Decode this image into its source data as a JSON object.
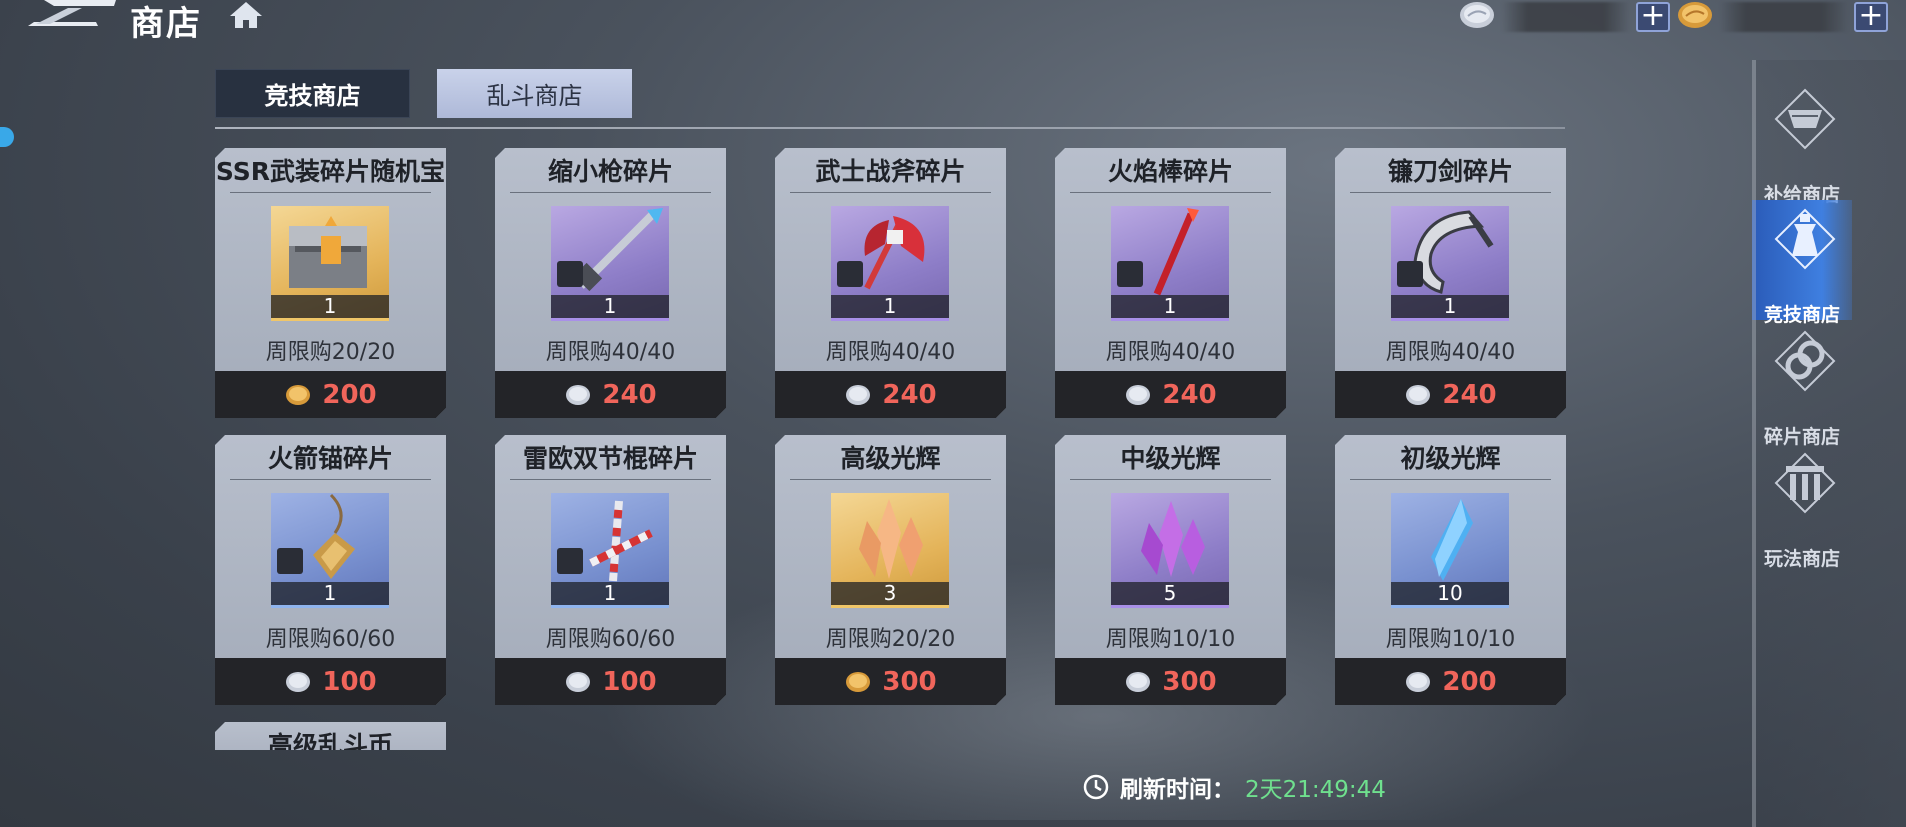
{
  "header": {
    "title": "商店"
  },
  "currencies": [
    {
      "icon": "silver-coin-icon",
      "amount": ""
    },
    {
      "icon": "gold-coin-icon",
      "amount": ""
    }
  ],
  "tabs": [
    {
      "label": "竞技商店",
      "active": true
    },
    {
      "label": "乱斗商店",
      "active": false
    }
  ],
  "items": [
    {
      "name": "SSR武装碎片随机宝",
      "qty": "1",
      "limit": "周限购20/20",
      "price": "200",
      "coin": "gold",
      "rarity": "gold"
    },
    {
      "name": "缩小枪碎片",
      "qty": "1",
      "limit": "周限购40/40",
      "price": "240",
      "coin": "silver",
      "rarity": "purple"
    },
    {
      "name": "武士战斧碎片",
      "qty": "1",
      "limit": "周限购40/40",
      "price": "240",
      "coin": "silver",
      "rarity": "purple"
    },
    {
      "name": "火焰棒碎片",
      "qty": "1",
      "limit": "周限购40/40",
      "price": "240",
      "coin": "silver",
      "rarity": "purple"
    },
    {
      "name": "镰刀剑碎片",
      "qty": "1",
      "limit": "周限购40/40",
      "price": "240",
      "coin": "silver",
      "rarity": "purple"
    },
    {
      "name": "火箭锚碎片",
      "qty": "1",
      "limit": "周限购60/60",
      "price": "100",
      "coin": "silver",
      "rarity": "blue"
    },
    {
      "name": "雷欧双节棍碎片",
      "qty": "1",
      "limit": "周限购60/60",
      "price": "100",
      "coin": "silver",
      "rarity": "blue"
    },
    {
      "name": "高级光辉",
      "qty": "3",
      "limit": "周限购20/20",
      "price": "300",
      "coin": "gold",
      "rarity": "gold"
    },
    {
      "name": "中级光辉",
      "qty": "5",
      "limit": "周限购10/10",
      "price": "300",
      "coin": "silver",
      "rarity": "purple"
    },
    {
      "name": "初级光辉",
      "qty": "10",
      "limit": "周限购10/10",
      "price": "200",
      "coin": "silver",
      "rarity": "blue"
    }
  ],
  "partial_item": {
    "name": "高级乱斗币"
  },
  "refresh": {
    "label": "刷新时间：",
    "value": "2天21:49:44"
  },
  "side_nav": [
    {
      "label": "补给商店",
      "icon": "supply-cart-icon",
      "active": false
    },
    {
      "label": "竞技商店",
      "icon": "arena-tower-icon",
      "active": true
    },
    {
      "label": "碎片商店",
      "icon": "fragment-icon",
      "active": false
    },
    {
      "label": "玩法商店",
      "icon": "gate-icon",
      "active": false
    }
  ],
  "colors": {
    "price": "#f0655b",
    "refresh_value": "#6fe08e",
    "active_tab_bg": "#283140",
    "side_active": "#3f7fe0"
  }
}
